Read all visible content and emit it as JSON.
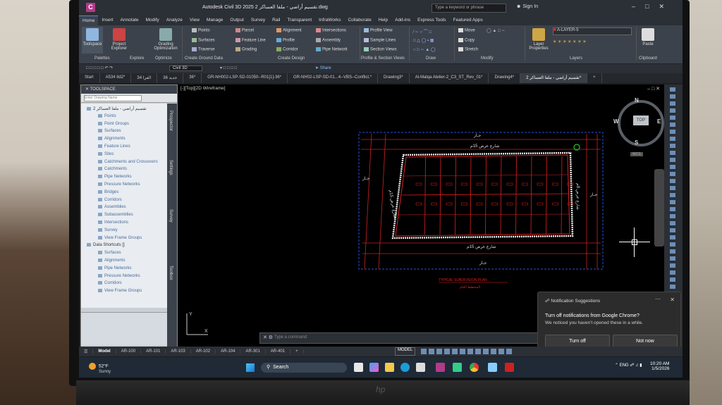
{
  "app": {
    "title": "Autodesk Civil 3D 2025  تقسيم أراضي - ملفا العساكر 2.dwg",
    "icon_letter": "C",
    "search_placeholder": "Type a keyword or phrase",
    "sign_in": "Sign In"
  },
  "ribbon": {
    "tabs": [
      "Home",
      "Insert",
      "Annotate",
      "Modify",
      "Analyze",
      "View",
      "Manage",
      "Output",
      "Survey",
      "Rail",
      "Transparent",
      "InfraWorks",
      "Collaborate",
      "Help",
      "Add-ins",
      "Express Tools",
      "Featured Apps"
    ],
    "active_tab": "Home",
    "big_buttons": [
      {
        "label": "Toolspace"
      },
      {
        "label": "Project Explorer"
      },
      {
        "label": "Grading Optimization"
      }
    ],
    "ground_items": [
      "Points",
      "Surfaces",
      "Traverse"
    ],
    "parcel_items": [
      "Parcel",
      "Feature Line",
      "Grading"
    ],
    "design_items": [
      "Alignment",
      "Profile",
      "Corridor"
    ],
    "design_items2": [
      "Intersections",
      "Assembly",
      "Pipe Network"
    ],
    "profile_items": [
      "Profile View",
      "Sample Lines",
      "Section Views"
    ],
    "modify_items": [
      "Move",
      "Copy",
      "Stretch"
    ],
    "layer_name": "A-LAYER-5",
    "layer_props": "Layer Properties",
    "paste": "Paste",
    "panels": [
      "Palettes",
      "Explore",
      "Optimize",
      "Create Ground Data",
      "Create Design",
      "Profile & Section Views",
      "Draw",
      "Modify",
      "Layers",
      "Clipboard"
    ]
  },
  "qat": {
    "workspace": "Civil 3D",
    "share": "Share"
  },
  "doc_tabs": [
    "Start",
    "A534 ltd2*",
    "34 الفرا",
    "جديد 36",
    "36*",
    "GR-NH002-LSP-SD-01050--R01[1]-36*",
    "GR-NH02-LSP-SD-01...4--VBS--Conflict.*",
    "Drawing3*",
    "Al-Malqa Atelier-2_C3_ST_Rev_01*",
    "Drawing4*",
    "تقسيم أراضي - ملفا العساكر 2*"
  ],
  "toolspace": {
    "header": "TOOLSPACE",
    "search_placeholder": "Enter Drawing Name",
    "tree": [
      {
        "label": "تقسيم أراضي - ملفا العساكر 2",
        "dark": true
      },
      {
        "label": "Points"
      },
      {
        "label": "Point Groups"
      },
      {
        "label": "Surfaces"
      },
      {
        "label": "Alignments"
      },
      {
        "label": "Feature Lines"
      },
      {
        "label": "Sites"
      },
      {
        "label": "Catchments and Crossovers"
      },
      {
        "label": "Catchments"
      },
      {
        "label": "Pipe Networks"
      },
      {
        "label": "Pressure Networks"
      },
      {
        "label": "Bridges"
      },
      {
        "label": "Corridors"
      },
      {
        "label": "Assemblies"
      },
      {
        "label": "Subassemblies"
      },
      {
        "label": "Intersections"
      },
      {
        "label": "Survey"
      },
      {
        "label": "View Frame Groups"
      },
      {
        "label": "Data Shortcuts []",
        "dark": true
      },
      {
        "label": "Surfaces"
      },
      {
        "label": "Alignments"
      },
      {
        "label": "Pipe Networks"
      },
      {
        "label": "Pressure Networks"
      },
      {
        "label": "Corridors"
      },
      {
        "label": "View Frame Groups"
      }
    ],
    "side_tabs": [
      "Prospector",
      "Settings",
      "Survey",
      "Toolbox"
    ]
  },
  "viewport": {
    "label": "[-][Top][2D Wireframe]",
    "compass": {
      "n": "N",
      "s": "S",
      "e": "E",
      "w": "W",
      "top": "TOP",
      "wcs": "WCS"
    },
    "drawing_texts": {
      "top_street": "شارع عرض 15م",
      "bottom_street": "شارع عرض 15م",
      "left_street": "شارع عرض 15م",
      "right_street": "شارع عرض 8م",
      "top_neighbor": "جـار",
      "bottom_neighbor": "جـار",
      "left_neighbor": "جـار",
      "right_neighbor": "جـار",
      "plan_title": "المخطط العام",
      "plan_sub": "TYPICAL SUBDIVISION PLAN"
    },
    "command_placeholder": "Type a command"
  },
  "notification": {
    "header": "Notification Suggestions",
    "title": "Turn off notifications from Google Chrome?",
    "body": "We noticed you haven't opened these in a while.",
    "btn_primary": "Turn off",
    "btn_secondary": "Not now"
  },
  "layout_tabs": [
    "Model",
    "AR-100",
    "AR-101",
    "AR-103",
    "AR-102",
    "AR-104",
    "AR-301",
    "AR-401"
  ],
  "status_model": "MODEL",
  "taskbar": {
    "temp": "52°F",
    "weather": "Sunny",
    "search": "Search",
    "lang": "ENG",
    "time": "10:20 AM",
    "date": "1/5/2026"
  },
  "laptop_brand": "hp",
  "colors": {
    "accent": "#4a8ad8",
    "cad_red": "#e02020",
    "cad_blue": "#2a4fd8",
    "cad_white": "#e8e8e8"
  }
}
